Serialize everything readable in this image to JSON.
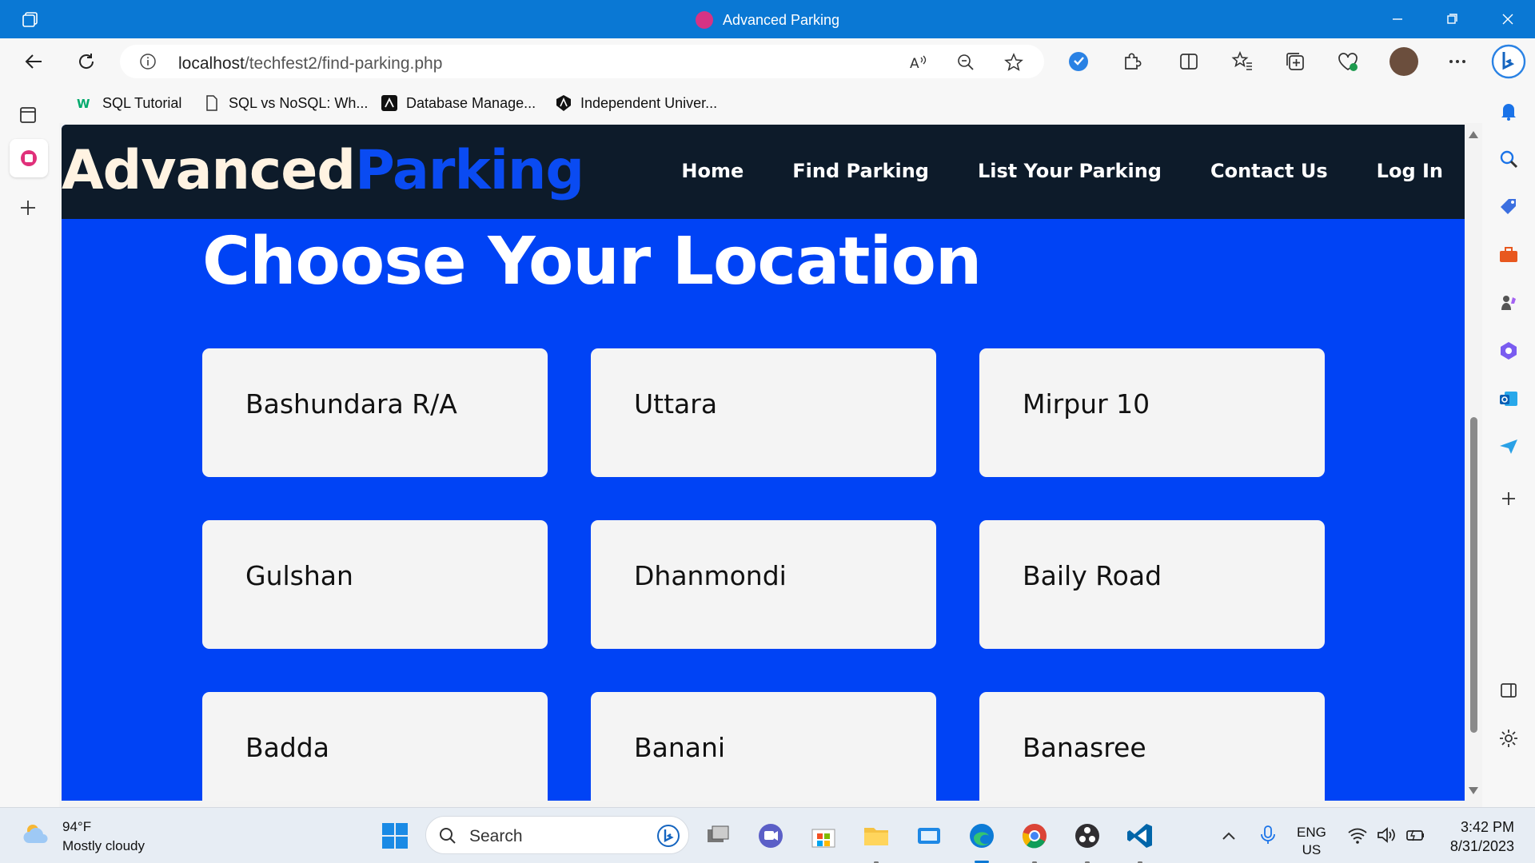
{
  "window": {
    "title": "Advanced Parking",
    "tab_icon": "tab-actions-icon"
  },
  "toolbar": {
    "url_host": "localhost",
    "url_path": "/techfest2/find-parking.php"
  },
  "bookmarks": [
    {
      "label": "SQL Tutorial",
      "icon": "w3schools-icon"
    },
    {
      "label": "SQL vs NoSQL: Wh...",
      "icon": "page-icon"
    },
    {
      "label": "Database Manage...",
      "icon": "database-icon"
    },
    {
      "label": "Independent Univer...",
      "icon": "university-icon"
    }
  ],
  "site": {
    "logo_part1": "Advanced",
    "logo_part2": "Parking",
    "nav": [
      "Home",
      "Find Parking",
      "List Your Parking",
      "Contact Us",
      "Log In"
    ],
    "page_title": "Choose Your Location",
    "locations": [
      "Bashundara R/A",
      "Uttara",
      "Mirpur 10",
      "Gulshan",
      "Dhanmondi",
      "Baily Road",
      "Badda",
      "Banani",
      "Banasree"
    ]
  },
  "colors": {
    "titlebar": "#0a78d4",
    "page_bg": "#0043f5",
    "header_bg": "#0d1b2a",
    "logo_accent": "#0a4bf2"
  },
  "taskbar": {
    "weather_temp": "94°F",
    "weather_desc": "Mostly cloudy",
    "search_label": "Search",
    "lang_line1": "ENG",
    "lang_line2": "US",
    "time": "3:42 PM",
    "date": "8/31/2023"
  }
}
